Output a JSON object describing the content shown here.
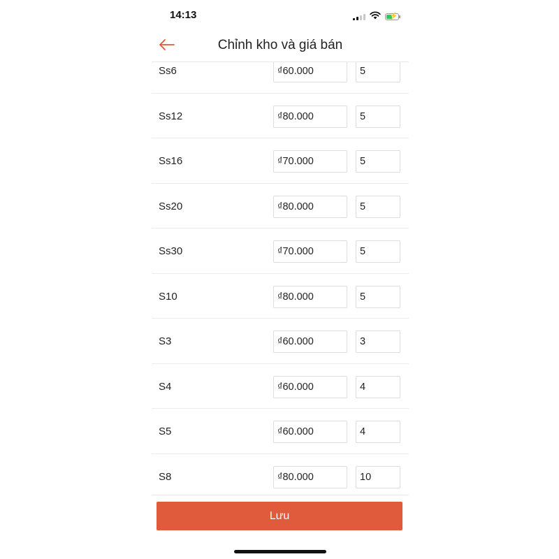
{
  "status_bar": {
    "time": "14:13",
    "icons": [
      "signal-icon",
      "wifi-icon",
      "battery-charging-icon"
    ]
  },
  "nav": {
    "title": "Chỉnh kho và giá bán",
    "back_icon": "arrow-left-icon",
    "accent_color": "#df5b3b"
  },
  "variants": [
    {
      "name": "Ss6",
      "price": "₫60.000",
      "stock": "5"
    },
    {
      "name": "Ss12",
      "price": "₫80.000",
      "stock": "5"
    },
    {
      "name": "Ss16",
      "price": "₫70.000",
      "stock": "5"
    },
    {
      "name": "Ss20",
      "price": "₫80.000",
      "stock": "5"
    },
    {
      "name": "Ss30",
      "price": "₫70.000",
      "stock": "5"
    },
    {
      "name": "S10",
      "price": "₫80.000",
      "stock": "5"
    },
    {
      "name": "S3",
      "price": "₫60.000",
      "stock": "3"
    },
    {
      "name": "S4",
      "price": "₫60.000",
      "stock": "4"
    },
    {
      "name": "S5",
      "price": "₫60.000",
      "stock": "4"
    },
    {
      "name": "S8",
      "price": "₫80.000",
      "stock": "10"
    }
  ],
  "footer": {
    "save_label": "Lưu",
    "button_color": "#df5b3b"
  }
}
